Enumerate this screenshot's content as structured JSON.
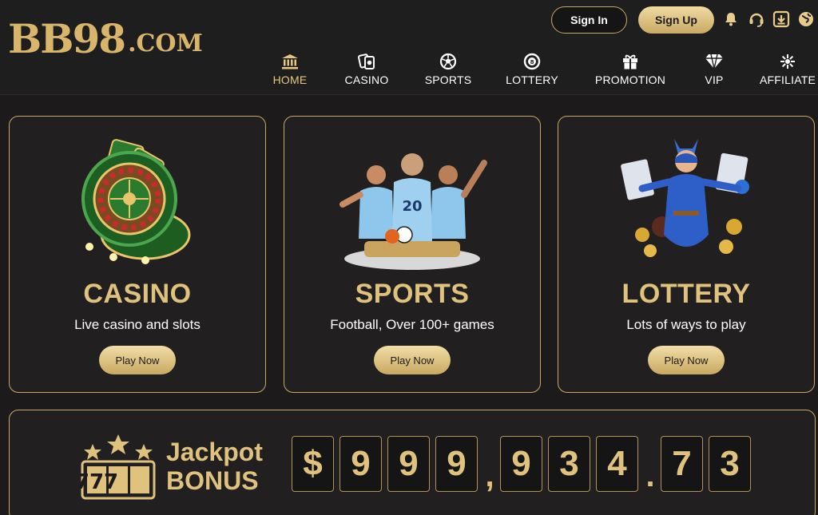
{
  "header": {
    "logo_main": "BB98",
    "logo_suffix": ".COM",
    "sign_in_label": "Sign In",
    "sign_up_label": "Sign Up",
    "tools": [
      "bell-icon",
      "headset-icon",
      "download-icon",
      "globe-icon"
    ]
  },
  "nav": {
    "items": [
      {
        "label": "HOME",
        "icon": "bank-icon",
        "active": true
      },
      {
        "label": "CASINO",
        "icon": "cards-icon",
        "active": false
      },
      {
        "label": "SPORTS",
        "icon": "soccer-ball-icon",
        "active": false
      },
      {
        "label": "LOTTERY",
        "icon": "lottery-ball-icon",
        "active": false
      },
      {
        "label": "PROMOTION",
        "icon": "gift-icon",
        "active": false
      },
      {
        "label": "VIP",
        "icon": "diamond-icon",
        "active": false
      },
      {
        "label": "AFFILIATE",
        "icon": "affiliate-icon",
        "active": false
      }
    ]
  },
  "cards": [
    {
      "title": "CASINO",
      "subtitle": "Live casino and slots",
      "button": "Play Now",
      "image": "roulette-wheel-image"
    },
    {
      "title": "SPORTS",
      "subtitle": "Football, Over 100+ games",
      "button": "Play Now",
      "image": "football-players-image"
    },
    {
      "title": "LOTTERY",
      "subtitle": "Lots of ways to play",
      "button": "Play Now",
      "image": "lottery-heroine-image"
    }
  ],
  "jackpot": {
    "line1": "Jackpot",
    "line2": "BONUS",
    "icon_text": "777",
    "chars": [
      "$",
      "9",
      "9",
      "9",
      ",",
      "9",
      "3",
      "4",
      ".",
      "7",
      "3"
    ]
  },
  "colors": {
    "gold": "#dfc27e",
    "background": "#1c1a1b",
    "card": "#211f20",
    "border": "#c9a966"
  }
}
